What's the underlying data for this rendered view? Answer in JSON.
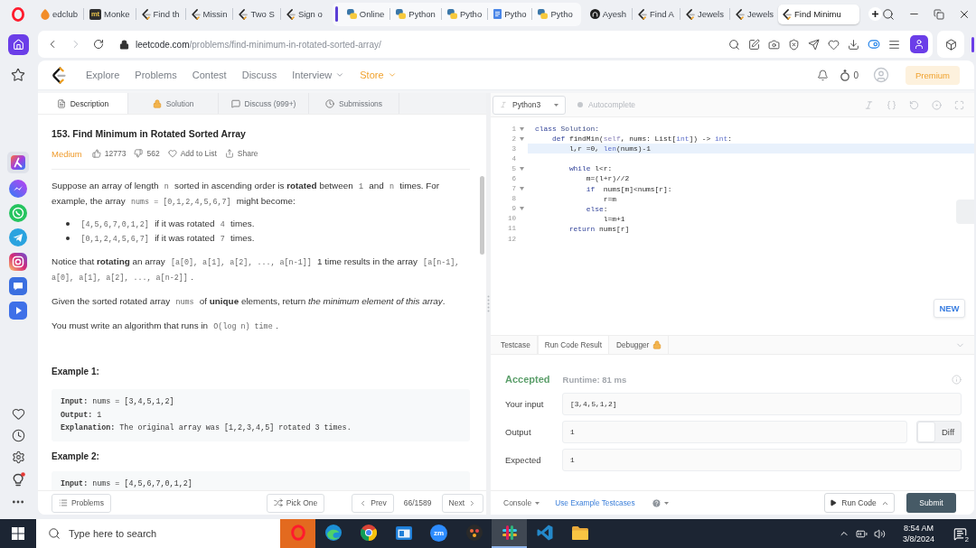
{
  "browser": {
    "tabs": [
      {
        "kind": "drop",
        "label": "edclub",
        "selected": false
      },
      {
        "kind": "letters",
        "label": "Monke",
        "glyph": "mt",
        "selected": false
      },
      {
        "kind": "bracket",
        "label": "Find th",
        "selected": false
      },
      {
        "kind": "bracket",
        "label": "Missin",
        "selected": false
      },
      {
        "kind": "bracket",
        "label": "Two S",
        "selected": false
      },
      {
        "kind": "bracket",
        "label": "Sign o",
        "selected": false
      },
      {
        "kind": "group",
        "tabs": [
          {
            "kind": "snake",
            "label": "Online",
            "selected": false
          },
          {
            "kind": "snake",
            "label": "Python",
            "selected": false
          },
          {
            "kind": "snake",
            "label": "Pytho",
            "selected": false
          },
          {
            "kind": "document",
            "label": "Pytho",
            "selected": false
          },
          {
            "kind": "snake",
            "label": "Pytho",
            "selected": false
          }
        ]
      },
      {
        "kind": "cat",
        "label": "Ayesh",
        "selected": false
      },
      {
        "kind": "bracket",
        "label": "Find A",
        "selected": false
      },
      {
        "kind": "bracket",
        "label": "Jewels",
        "selected": false
      },
      {
        "kind": "bracket",
        "label": "Jewels",
        "selected": false
      },
      {
        "kind": "bracket",
        "label": "Find Minimu",
        "selected": true
      }
    ],
    "url_host": "leetcode.com",
    "url_path": "/problems/find-minimum-in-rotated-sorted-array/"
  },
  "site_nav": {
    "links": [
      {
        "label": "Explore",
        "dropdown": false,
        "accent": false
      },
      {
        "label": "Problems",
        "dropdown": false,
        "accent": false
      },
      {
        "label": "Contest",
        "dropdown": false,
        "accent": false
      },
      {
        "label": "Discuss",
        "dropdown": false,
        "accent": false
      },
      {
        "label": "Interview",
        "dropdown": true,
        "accent": false
      },
      {
        "label": "Store",
        "dropdown": true,
        "accent": true
      }
    ],
    "coins": "0",
    "premium": "Premium"
  },
  "problem_tabs": [
    {
      "label": "Description",
      "kind": "description",
      "selected": true
    },
    {
      "label": "Solution",
      "kind": "solution",
      "selected": false
    },
    {
      "label": "Discuss (999+)",
      "kind": "discuss",
      "selected": false
    },
    {
      "label": "Submissions",
      "kind": "submissions",
      "selected": false
    }
  ],
  "problem": {
    "title": "153. Find Minimum in Rotated Sorted Array",
    "difficulty": "Medium",
    "likes": "12773",
    "dislikes": "562",
    "add_to_list": "Add to List",
    "share": "Share",
    "description": [
      {
        "kind": "paragraph",
        "segments": [
          {
            "text": "Suppose an array of length ",
            "kind": "text"
          },
          {
            "text": "n",
            "kind": "code"
          },
          {
            "text": " sorted in ascending order is **rotated** between ",
            "kind": "text"
          },
          {
            "text": "1",
            "kind": "code"
          },
          {
            "text": " and ",
            "kind": "text"
          },
          {
            "text": "n",
            "kind": "code"
          },
          {
            "text": " times. For example, the array ",
            "kind": "text"
          },
          {
            "text": "nums = [0,1,2,4,5,6,7]",
            "kind": "code"
          },
          {
            "text": " might become:",
            "kind": "text"
          }
        ]
      },
      {
        "kind": "list",
        "items": [
          {
            "segments": [
              {
                "text": "[4,5,6,7,0,1,2]",
                "kind": "code"
              },
              {
                "text": " if it was rotated ",
                "kind": "text"
              },
              {
                "text": "4",
                "kind": "code"
              },
              {
                "text": " times.",
                "kind": "text"
              }
            ]
          },
          {
            "segments": [
              {
                "text": "[0,1,2,4,5,6,7]",
                "kind": "code"
              },
              {
                "text": " if it was rotated ",
                "kind": "text"
              },
              {
                "text": "7",
                "kind": "code"
              },
              {
                "text": " times.",
                "kind": "text"
              }
            ]
          }
        ]
      },
      {
        "kind": "paragraph",
        "segments": [
          {
            "text": "Notice that **rotating** an array ",
            "kind": "text"
          },
          {
            "text": "[a[0], a[1], a[2], ..., a[n-1]]",
            "kind": "code"
          },
          {
            "text": " 1 time results in the array ",
            "kind": "text"
          },
          {
            "text": "[a[n-1], a[0], a[1], a[2], ..., a[n-2]]",
            "kind": "code"
          },
          {
            "text": ".",
            "kind": "text"
          }
        ]
      },
      {
        "kind": "paragraph",
        "segments": [
          {
            "text": "Given the sorted rotated array ",
            "kind": "text"
          },
          {
            "text": "nums",
            "kind": "code"
          },
          {
            "text": " of **unique** elements, return *the minimum element of this array*.",
            "kind": "text"
          }
        ]
      },
      {
        "kind": "paragraph",
        "segments": [
          {
            "text": "You must write an algorithm that runs in ",
            "kind": "text"
          },
          {
            "text": "O(log n) time",
            "kind": "code"
          },
          {
            "text": ".",
            "kind": "text"
          }
        ]
      }
    ],
    "examples": [
      {
        "title": "Example 1:",
        "lines": [
          "**Input:** nums = [3,4,5,1,2]",
          "**Output:** 1",
          "**Explanation:** The original array was [1,2,3,4,5] rotated 3 times."
        ]
      },
      {
        "title": "Example 2:",
        "lines": [
          "**Input:** nums = [4,5,6,7,0,1,2]"
        ]
      }
    ]
  },
  "problem_footer": {
    "problems": "Problems",
    "pick_one": "Pick One",
    "prev": "Prev",
    "position": "66/1589",
    "next": "Next"
  },
  "editor": {
    "language": "Python3",
    "autocomplete": {
      "label": "Autocomplete",
      "on": false
    },
    "new_button": "NEW",
    "lines": [
      {
        "number": "1",
        "fold": true,
        "active": false,
        "tokens": [
          {
            "text": "class",
            "kind": "keyword"
          },
          {
            "text": " Solution:",
            "kind": "name"
          }
        ]
      },
      {
        "number": "2",
        "fold": true,
        "active": false,
        "tokens": [
          {
            "text": "    def",
            "kind": "keyword"
          },
          {
            "text": " findMin(",
            "kind": "plain"
          },
          {
            "text": "self",
            "kind": "self"
          },
          {
            "text": ", nums: List[",
            "kind": "plain"
          },
          {
            "text": "int",
            "kind": "builtin"
          },
          {
            "text": "]) -> ",
            "kind": "plain"
          },
          {
            "text": "int",
            "kind": "builtin"
          },
          {
            "text": ":",
            "kind": "plain"
          }
        ]
      },
      {
        "number": "3",
        "fold": false,
        "active": true,
        "tokens": [
          {
            "text": "        l,r =0, ",
            "kind": "plain"
          },
          {
            "text": "len",
            "kind": "builtin"
          },
          {
            "text": "(nums)-1",
            "kind": "plain"
          }
        ]
      },
      {
        "number": "4",
        "fold": false,
        "active": false
      },
      {
        "number": "5",
        "fold": true,
        "active": false,
        "tokens": [
          {
            "text": "        while",
            "kind": "keyword"
          },
          {
            "text": " l<r:",
            "kind": "plain"
          }
        ]
      },
      {
        "number": "6",
        "fold": false,
        "active": false,
        "tokens": [
          {
            "text": "            m=(l+r)//2",
            "kind": "plain"
          }
        ]
      },
      {
        "number": "7",
        "fold": true,
        "active": false,
        "tokens": [
          {
            "text": "            if",
            "kind": "keyword"
          },
          {
            "text": "  nums[m]<nums[r]:",
            "kind": "plain"
          }
        ]
      },
      {
        "number": "8",
        "fold": false,
        "active": false,
        "tokens": [
          {
            "text": "                r=m",
            "kind": "plain"
          }
        ]
      },
      {
        "number": "9",
        "fold": true,
        "active": false,
        "tokens": [
          {
            "text": "            else",
            "kind": "keyword"
          },
          {
            "text": ":",
            "kind": "plain"
          }
        ]
      },
      {
        "number": "10",
        "fold": false,
        "active": false,
        "tokens": [
          {
            "text": "                l=m+1",
            "kind": "plain"
          }
        ]
      },
      {
        "number": "11",
        "fold": false,
        "active": false,
        "tokens": [
          {
            "text": "        return",
            "kind": "keyword"
          },
          {
            "text": " nums[r]",
            "kind": "plain"
          }
        ]
      },
      {
        "number": "12",
        "fold": false,
        "active": false
      }
    ]
  },
  "console": {
    "tabs": [
      {
        "label": "Testcase",
        "selected": false,
        "locked": false
      },
      {
        "label": "Run Code Result",
        "selected": true,
        "locked": false
      },
      {
        "label": "Debugger",
        "selected": false,
        "locked": true
      }
    ],
    "status": "Accepted",
    "runtime": "Runtime: 81 ms",
    "rows": [
      {
        "label": "Your input",
        "value": "[3,4,5,1,2]",
        "kind": "plain"
      },
      {
        "label": "Output",
        "value": "1",
        "kind": "diff"
      },
      {
        "label": "Expected",
        "value": "1",
        "kind": "plain"
      }
    ],
    "diff": {
      "label": "Diff",
      "on": false
    }
  },
  "console_footer": {
    "console": "Console",
    "use_example": "Use Example Testcases",
    "run": "Run Code",
    "submit": "Submit"
  },
  "taskbar": {
    "search_placeholder": "Type here to search",
    "apps": [
      {
        "kind": "ring",
        "highlighted": true,
        "open": false
      },
      {
        "kind": "wave",
        "highlighted": false,
        "open": false
      },
      {
        "kind": "tricolor",
        "highlighted": false,
        "open": false
      },
      {
        "kind": "window",
        "highlighted": false,
        "open": false
      },
      {
        "kind": "badge",
        "glyph": "zm",
        "highlighted": false,
        "open": false
      },
      {
        "kind": "dots",
        "highlighted": false,
        "open": false
      },
      {
        "kind": "hash",
        "highlighted": false,
        "open": true
      },
      {
        "kind": "ribbon",
        "highlighted": false,
        "open": false
      },
      {
        "kind": "folder",
        "highlighted": false,
        "open": false
      }
    ],
    "time": "8:54 AM",
    "date": "3/8/2024",
    "notifications": "2"
  }
}
